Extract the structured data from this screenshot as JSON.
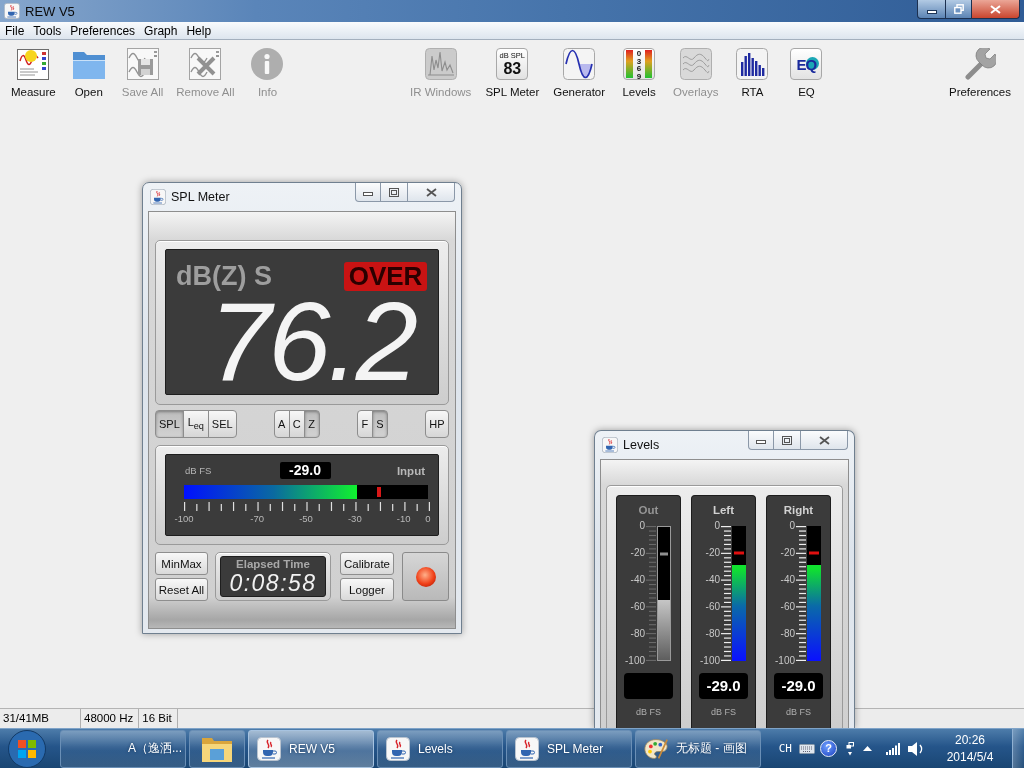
{
  "window": {
    "title": "REW V5"
  },
  "menu": [
    "File",
    "Tools",
    "Preferences",
    "Graph",
    "Help"
  ],
  "toolbar": {
    "left": [
      {
        "kind": "measure",
        "label": "Measure",
        "disabled": false
      },
      {
        "kind": "open",
        "label": "Open",
        "disabled": false
      },
      {
        "kind": "save_all",
        "label": "Save All",
        "disabled": true
      },
      {
        "kind": "remove_all",
        "label": "Remove All",
        "disabled": true
      },
      {
        "kind": "info",
        "label": "Info",
        "disabled": true
      }
    ],
    "center": [
      {
        "kind": "ir_windows",
        "label": "IR Windows",
        "disabled": true
      },
      {
        "kind": "spl_meter",
        "label": "SPL Meter",
        "disabled": false,
        "icon_text": [
          "dB SPL",
          "83"
        ]
      },
      {
        "kind": "generator",
        "label": "Generator",
        "disabled": false
      },
      {
        "kind": "levels",
        "label": "Levels",
        "disabled": false,
        "icon_text": [
          "0369"
        ]
      },
      {
        "kind": "overlays",
        "label": "Overlays",
        "disabled": true
      },
      {
        "kind": "rta",
        "label": "RTA",
        "disabled": false
      },
      {
        "kind": "eq",
        "label": "EQ",
        "disabled": false,
        "icon_text": [
          "EQ"
        ]
      }
    ],
    "right": [
      {
        "kind": "preferences",
        "label": "Preferences",
        "disabled": false
      }
    ]
  },
  "spl_meter_window": {
    "title": "SPL Meter",
    "display": {
      "mode": "dB(Z) S",
      "over": {
        "label": "OVER",
        "on": true
      },
      "reading": "76.2"
    },
    "mode_buttons": [
      {
        "label": "SPL",
        "selected": true
      },
      {
        "label": "L$_{eq}$",
        "selected": false
      },
      {
        "label": "SEL",
        "selected": false
      }
    ],
    "weighting_buttons": [
      {
        "label": "A",
        "selected": false
      },
      {
        "label": "C",
        "selected": false
      },
      {
        "label": "Z",
        "selected": true
      }
    ],
    "response_buttons": [
      {
        "label": "F",
        "selected": false
      },
      {
        "label": "S",
        "selected": true
      }
    ],
    "filter_buttons": [
      {
        "label": "HP",
        "selected": false
      }
    ],
    "input": {
      "unit": "dB FS",
      "reading": "-29.0",
      "label": "Input",
      "level": 0.71,
      "peak": {
        "level": 0.8
      },
      "scale": [
        "-100",
        "-70",
        "-50",
        "-30",
        "-10",
        "0"
      ]
    },
    "stats_buttons": [
      "MinMax",
      "Reset All"
    ],
    "elapsed": {
      "label": "Elapsed Time",
      "value": "0:08:58"
    },
    "log_buttons": [
      "Calibrate",
      "Logger"
    ],
    "record_indicator": {
      "on": true
    }
  },
  "levels_window": {
    "title": "Levels",
    "channels": [
      {
        "kind": "output",
        "name": "Out",
        "scale": [
          "0",
          "-20",
          "-40",
          "-60",
          "-80",
          "-100"
        ],
        "level": 0.45,
        "peak": {
          "level": 0.8
        },
        "unit": "dB FS"
      },
      {
        "kind": "input",
        "name": "Left",
        "scale": [
          "0",
          "-20",
          "-40",
          "-60",
          "-80",
          "-100"
        ],
        "level": 0.71,
        "peak": {
          "level": 0.8
        },
        "reading": "-29.0",
        "unit": "dB FS"
      },
      {
        "kind": "input",
        "name": "Right",
        "scale": [
          "0",
          "-20",
          "-40",
          "-60",
          "-80",
          "-100"
        ],
        "level": 0.71,
        "peak": {
          "level": 0.8
        },
        "reading": "-29.0",
        "unit": "dB FS"
      }
    ]
  },
  "status_bar": [
    "31/41MB",
    "48000 Hz",
    "16 Bit"
  ],
  "taskbar": {
    "buttons": [
      {
        "kind": "plain",
        "label": "A（逸洒...",
        "selected": false
      },
      {
        "kind": "folder",
        "selected": false
      },
      {
        "kind": "java",
        "label": "REW V5",
        "selected": true
      },
      {
        "kind": "java",
        "label": "Levels",
        "selected": false
      },
      {
        "kind": "java",
        "label": "SPL Meter",
        "selected": false
      },
      {
        "kind": "paint",
        "label": "无标题 - 画图",
        "selected": false
      }
    ],
    "tray": {
      "language": "CH",
      "help": "?",
      "time": "20:26",
      "date": "2014/5/4"
    }
  }
}
